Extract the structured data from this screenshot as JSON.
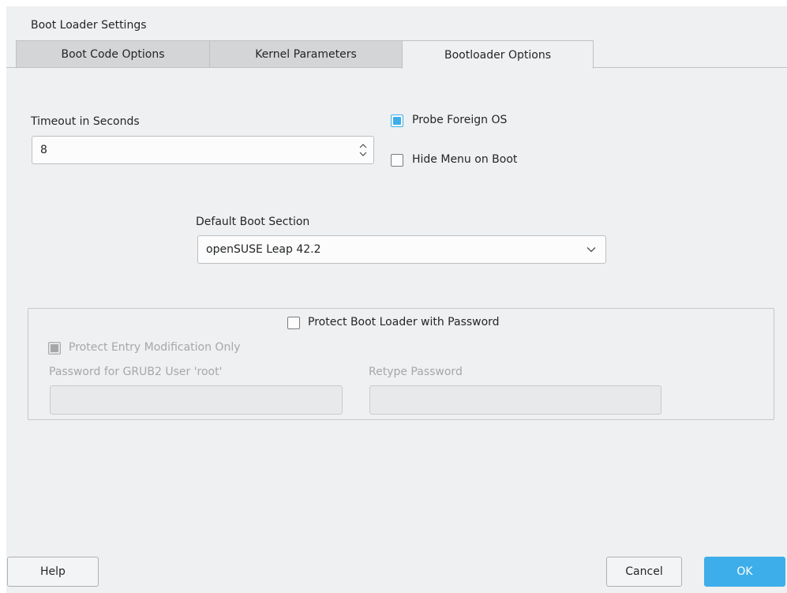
{
  "window": {
    "title": "Boot Loader Settings"
  },
  "tabs": [
    {
      "label": "Boot Code Options"
    },
    {
      "label": "Kernel Parameters"
    },
    {
      "label": "Bootloader Options",
      "active": true
    }
  ],
  "timeout": {
    "label": "Timeout in Seconds",
    "value": "8"
  },
  "options": {
    "probe_foreign_os": {
      "label": "Probe Foreign OS",
      "checked": true
    },
    "hide_menu": {
      "label": "Hide Menu on Boot",
      "checked": false
    }
  },
  "default_boot": {
    "label": "Default Boot Section",
    "selected": "openSUSE Leap 42.2"
  },
  "password_group": {
    "protect_label": "Protect Boot Loader with Password",
    "protect_checked": false,
    "entry_mod_label": "Protect Entry Modification Only",
    "entry_mod_checked": true,
    "password_label": "Password for GRUB2 User 'root'",
    "retype_label": "Retype Password"
  },
  "buttons": {
    "help": "Help",
    "cancel": "Cancel",
    "ok": "OK"
  },
  "colors": {
    "accent": "#3daee9",
    "background": "#eff0f1",
    "text": "#232627",
    "disabled_text": "#a5a7a9"
  }
}
